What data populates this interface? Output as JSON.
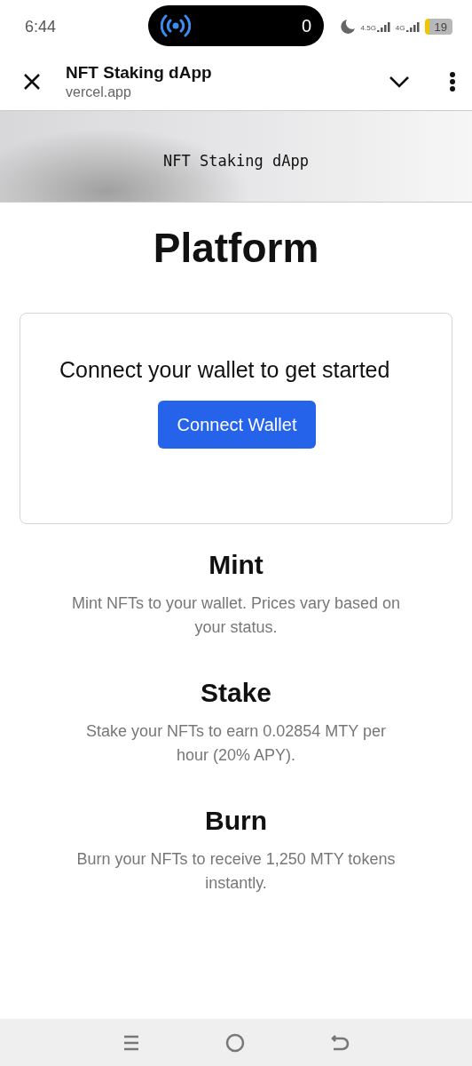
{
  "status_bar": {
    "time": "6:44",
    "pill_count": "0",
    "network_labels": [
      "4.5G",
      "4G"
    ],
    "battery": "19"
  },
  "browser_bar": {
    "title": "NFT Staking dApp",
    "url": "vercel.app"
  },
  "site_header": {
    "title": "NFT Staking dApp"
  },
  "heading": [
    "Platform"
  ],
  "connect_card": {
    "message": "Connect your wallet to get started",
    "button": "Connect Wallet"
  },
  "features": [
    {
      "title": "Mint",
      "description": "Mint NFTs to your wallet. Prices vary based on your status."
    },
    {
      "title": "Stake",
      "description": "Stake your NFTs to earn 0.02854 MTY per hour (20% APY)."
    },
    {
      "title": "Burn",
      "description": "Burn your NFTs to receive 1,250 MTY tokens instantly."
    }
  ]
}
